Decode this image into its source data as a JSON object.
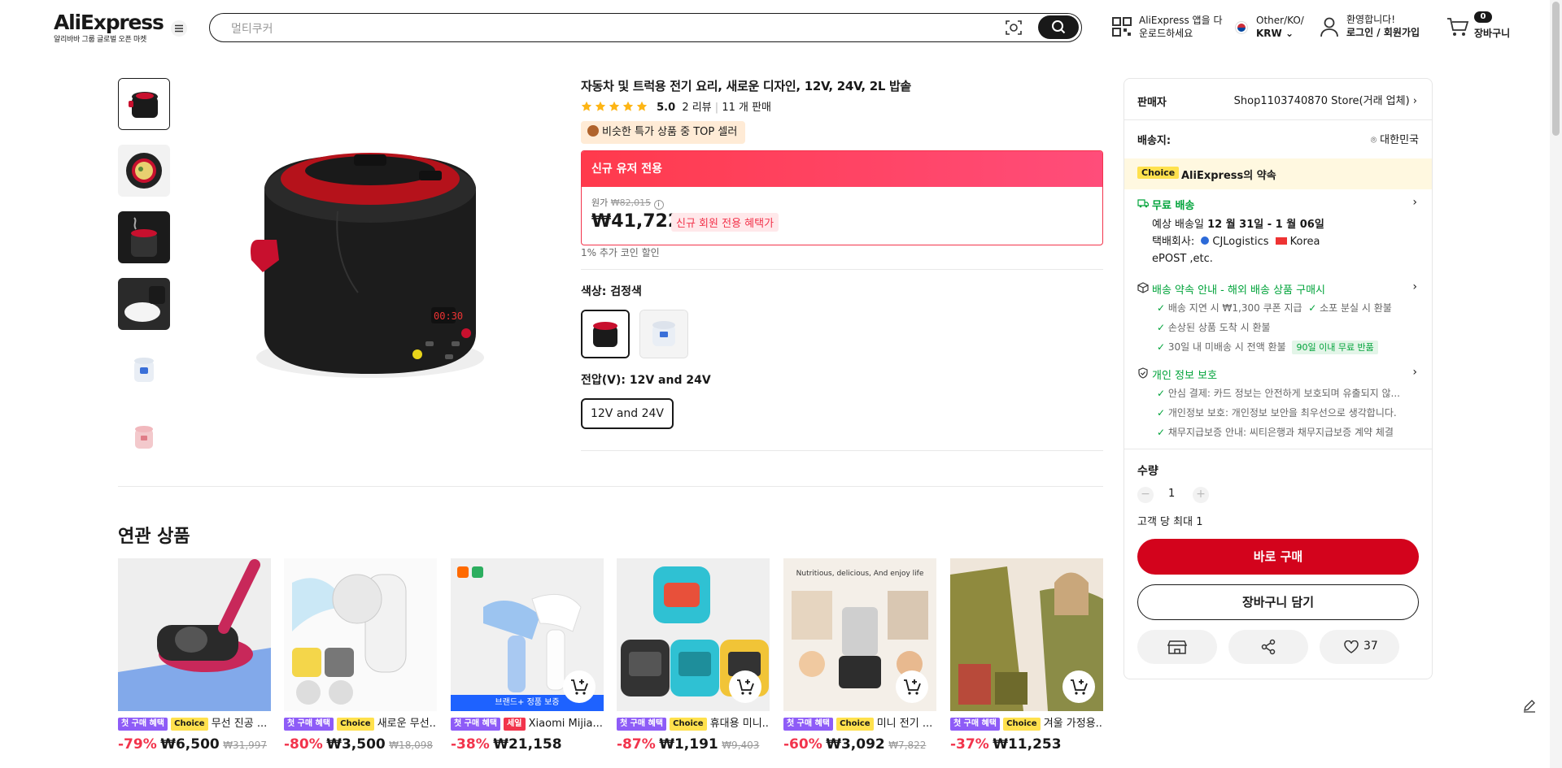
{
  "header": {
    "logo": "AliExpress",
    "logo_sub": "알리바바 그룹 글로벌 오픈 마켓",
    "search_placeholder": "멀티쿠커",
    "app_line1": "AliExpress 앱을 다",
    "app_line2": "운로드하세요",
    "region_line1": "Other/KO/",
    "region_line2": "KRW",
    "account_line1": "환영합니다!",
    "account_line2": "로그인 / 회원가입",
    "cart_count": "0",
    "cart_label": "장바구니"
  },
  "product": {
    "title": "자동차 및 트럭용 전기 요리, 새로운 디자인, 12V, 24V, 2L 밥솥",
    "rating": "5.0",
    "reviews": "2 리뷰",
    "sold": "11 개 판매",
    "top_badge": "비슷한 특가 상품 중 TOP 셀러",
    "promo_header": "신규 유저 전용",
    "orig_label": "원가",
    "orig_price": "₩82,015",
    "price": "₩41,722",
    "new_member_tag": "신규 회원 전용 혜택가",
    "coin_note": "1% 추가 코인 할인",
    "color_label": "색상: 검정색",
    "voltage_label": "전압(V): 12V and 24V",
    "voltage_option": "12V and 24V"
  },
  "related": {
    "title": "연관 상품",
    "items": [
      {
        "tag1": "첫 구매 혜택",
        "tag2": "Choice",
        "name": "무선 진공 ...",
        "disc": "-79%",
        "price": "₩6,500",
        "orig": "₩31,997"
      },
      {
        "tag1": "첫 구매 혜택",
        "tag2": "Choice",
        "name": "새로운 무선...",
        "disc": "-80%",
        "price": "₩3,500",
        "orig": "₩18,098"
      },
      {
        "tag1": "첫 구매 혜택",
        "tag2": "세일",
        "name": "Xiaomi Mijia...",
        "disc": "-38%",
        "price": "₩21,158",
        "orig": ""
      },
      {
        "tag1": "첫 구매 혜택",
        "tag2": "Choice",
        "name": "휴대용 미니...",
        "disc": "-87%",
        "price": "₩1,191",
        "orig": "₩9,403"
      },
      {
        "tag1": "첫 구매 혜택",
        "tag2": "Choice",
        "name": "미니 전기 ...",
        "disc": "-60%",
        "price": "₩3,092",
        "orig": "₩7,822"
      },
      {
        "tag1": "첫 구매 혜택",
        "tag2": "Choice",
        "name": "겨울 가정용...",
        "disc": "-37%",
        "price": "₩11,253",
        "orig": ""
      }
    ],
    "brand_banner": "브랜드+ 정품 보증",
    "img4_caption": "Nutritious, delicious, And enjoy life"
  },
  "side": {
    "seller_label": "판매자",
    "seller_name": "Shop1103740870 Store(거래 업체)",
    "ship_to_label": "배송지:",
    "ship_to": "대한민국",
    "choice_badge": "Choice",
    "promise": "AliExpress의 약속",
    "free_ship": "무료 배송",
    "est_label": "예상 배송일",
    "est_date": "12 월 31일 - 1 월 06일",
    "carrier_label": "택배회사:",
    "carrier1": "CJLogistics",
    "carrier2": "Korea",
    "carrier3": "ePOST ,etc.",
    "promise_title": "배송 약속 안내 - 해외 배송 상품 구매시",
    "b1": "배송 지연 시 ₩1,300 쿠폰 지급",
    "b2": "소포 분실 시 환불",
    "b3": "손상된 상품 도착 시 환불",
    "b4": "30일 내 미배송 시 전액 환불",
    "b4_tag": "90일 이내 무료 반품",
    "privacy_title": "개인 정보 보호",
    "p1": "안심 결제: 카드 정보는 안전하게 보호되며 유출되지 않...",
    "p2": "개인정보 보호: 개인정보 보안을 최우선으로 생각합니다.",
    "p3": "채무지급보증 안내: 씨티은행과 채무지급보증 계약 체결",
    "qty_label": "수량",
    "qty": "1",
    "max_note": "고객 당 최대 1",
    "buy_now": "바로 구매",
    "add_cart": "장바구니 담기",
    "likes": "37"
  },
  "colors": {
    "accent": "#d3031c",
    "promo": "#f2344c",
    "green": "#00a33a",
    "choice": "#ffe14d"
  }
}
